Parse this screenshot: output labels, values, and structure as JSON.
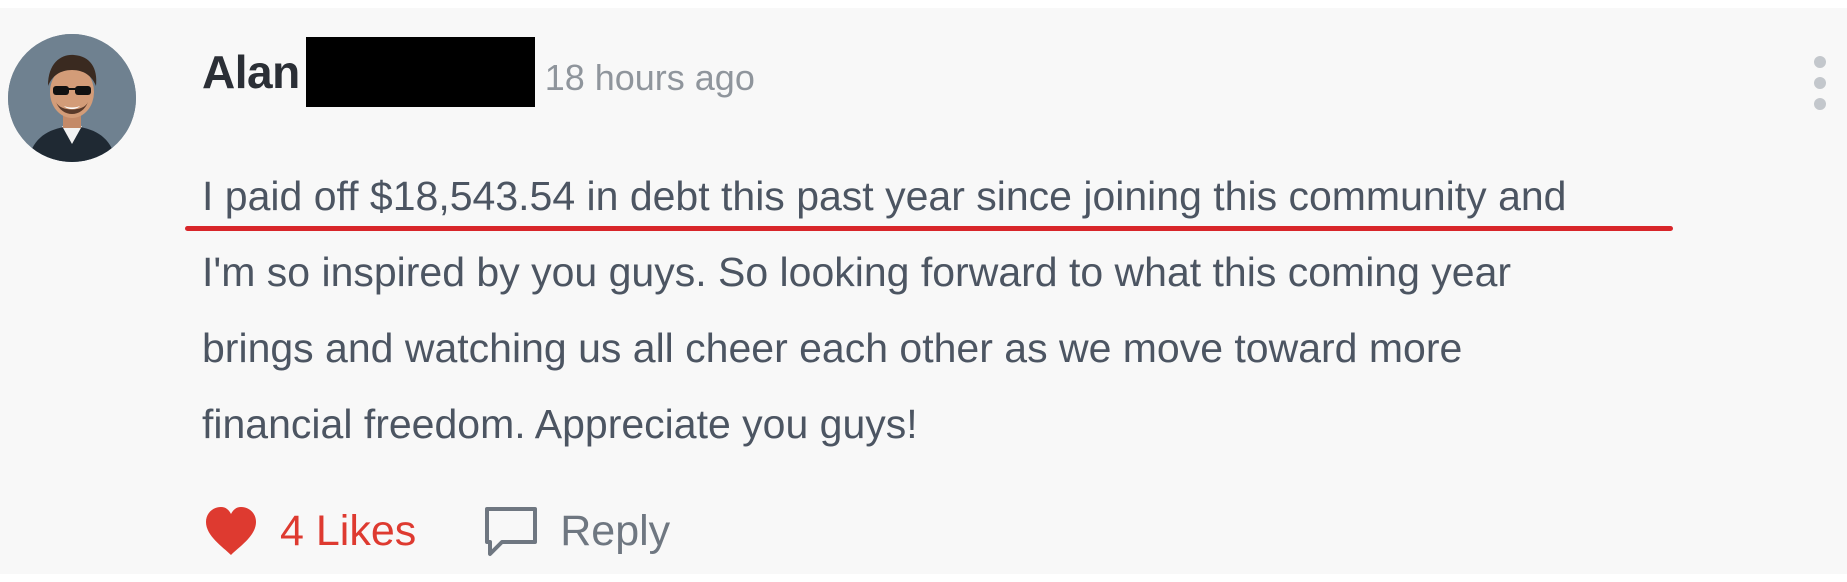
{
  "comment": {
    "author": {
      "name": "Alan",
      "avatar_icon": "user-avatar-photo"
    },
    "timestamp": "18 hours ago",
    "more_menu_icon": "vertical-ellipsis-icon",
    "body_lines": [
      "I paid off $18,543.54 in debt this past year since joining this community and",
      "I'm so inspired by you guys. So looking forward to what this coming year",
      "brings and watching us all cheer each other as we move toward more",
      "financial freedom. Appreciate you guys!"
    ],
    "actions": {
      "like_icon": "heart-icon",
      "likes_label": "4 Likes",
      "reply_icon": "speech-bubble-icon",
      "reply_label": "Reply"
    }
  },
  "colors": {
    "like_accent": "#de3a30",
    "annotation_underline": "#d8262a",
    "body_text": "#4c5562",
    "muted_text": "#8f959c",
    "card_background": "#f8f8f8"
  }
}
